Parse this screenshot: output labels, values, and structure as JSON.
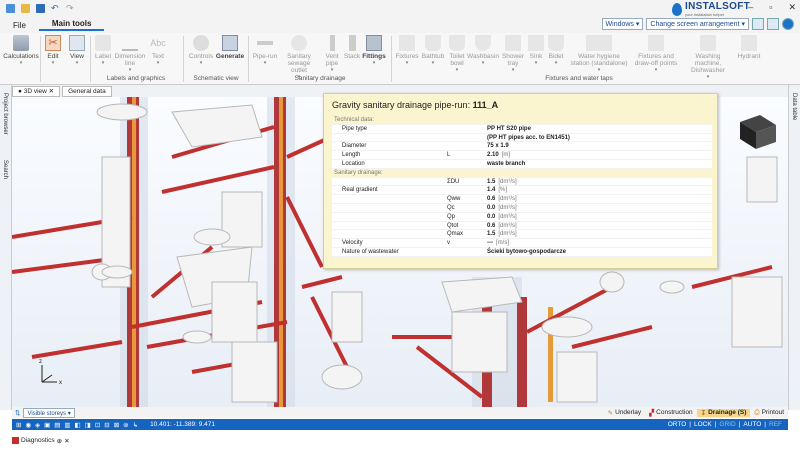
{
  "brand": {
    "name": "INSTALSOFT",
    "tagline": "your instalation helper"
  },
  "menu": {
    "file": "File",
    "main_tools": "Main tools"
  },
  "topright": {
    "windows": "Windows",
    "screen_arrangement": "Change screen arrangement"
  },
  "ribbon": {
    "calculations": "Calculations",
    "edit": "Edit",
    "view": "View",
    "label": "Label",
    "dimension": "Dimension line",
    "text": "Text",
    "controls": "Controls",
    "generate": "Generate",
    "pipe_run": "Pipe-run",
    "sanitary_outlet": "Sanitary sewage outlet",
    "vent_pipe": "Vent pipe",
    "stack": "Stack",
    "fittings": "Fittings",
    "fixtures": "Fixtures",
    "bathtub": "Bathtub",
    "toilet_bowl": "Toilet bowl",
    "washbasin": "Washbasin",
    "shower_tray": "Shower tray",
    "sink": "Sink",
    "bidet": "Bidet",
    "water_hygiene": "Water hygiene station (standalone)",
    "fixtures_drawoff": "Fixtures and draw-off points",
    "washing_machine": "Washing machine, Dishwasher",
    "hydrant": "Hydrant",
    "groups": {
      "labels_graphics": "Labels and graphics",
      "schematic_view": "Schematic view",
      "sanitary_drainage": "Sanitary drainage",
      "fixtures_taps": "Fixtures and water taps"
    }
  },
  "tabs": {
    "view3d": "3D view",
    "general": "General data"
  },
  "left_panels": {
    "project_browser": "Project browser",
    "search": "Search"
  },
  "right_panels": {
    "data_table": "Data table"
  },
  "popup": {
    "title_prefix": "Gravity sanitary drainage pipe-run:",
    "title_id": "111_A",
    "rows": [
      {
        "kind": "sec",
        "label": "Technical data:"
      },
      {
        "label": "Pipe type",
        "sym": "",
        "value": "PP HT S20 pipe",
        "unit": ""
      },
      {
        "label": "",
        "sym": "",
        "value": "(PP HT pipes acc. to EN1451)",
        "unit": ""
      },
      {
        "label": "Diameter",
        "sym": "",
        "value": "75 x 1.9",
        "unit": ""
      },
      {
        "label": "Length",
        "sym": "L",
        "value": "2.10",
        "unit": "[m]"
      },
      {
        "label": "Location",
        "sym": "",
        "value": "waste branch",
        "unit": ""
      },
      {
        "kind": "sec",
        "label": "Sanitary drainage:"
      },
      {
        "label": "",
        "sym": "ΣDU",
        "value": "1.5",
        "unit": "[dm³/s]"
      },
      {
        "label": "Real gradient",
        "sym": "",
        "value": "1.4",
        "unit": "[%]"
      },
      {
        "label": "",
        "sym": "Qww",
        "value": "0.6",
        "unit": "[dm³/s]"
      },
      {
        "label": "",
        "sym": "Qc",
        "value": "0.0",
        "unit": "[dm³/s]"
      },
      {
        "label": "",
        "sym": "Qp",
        "value": "0.0",
        "unit": "[dm³/s]"
      },
      {
        "label": "",
        "sym": "Qtot",
        "value": "0.6",
        "unit": "[dm³/s]"
      },
      {
        "label": "",
        "sym": "Qmax",
        "value": "1.5",
        "unit": "[dm³/s]"
      },
      {
        "label": "Velocity",
        "sym": "v",
        "value": "---",
        "unit": "[m/s]"
      },
      {
        "label": "Nature of wastewater",
        "sym": "",
        "value": "Ścieki bytowo-gospodarcze",
        "unit": ""
      }
    ]
  },
  "bottombar": {
    "visible_storeys": "Visible storeys",
    "underlay": "Underlay",
    "construction": "Construction",
    "drainage": "Drainage (S)",
    "printout": "Printout"
  },
  "status": {
    "coords": "10.401: -11.389: 9.471",
    "orto": "ORTO",
    "lock": "LOCK",
    "grid": "GRID",
    "auto": "AUTO",
    "ref": "REF"
  },
  "diagnostics": "Diagnostics",
  "colors": {
    "accent": "#1565c0",
    "pipe": "#c0302f",
    "popup_bg": "#fbf5cf"
  }
}
